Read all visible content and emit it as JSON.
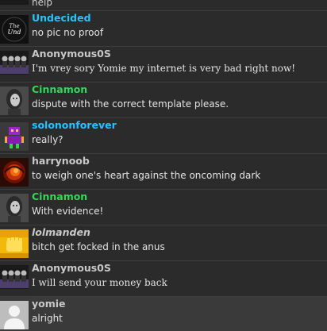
{
  "partial_message": {
    "text": "help",
    "avatar_icon": "anonymous-mask-avatar"
  },
  "messages": [
    {
      "user": "Undecided",
      "text": "no pic no proof",
      "user_color": "#23c4ff",
      "avatar_icon": "undecided-logo-avatar",
      "text_font": "sans"
    },
    {
      "user": "Anonymous0S",
      "text": "I'm vrey sory Yomie my internet is very bad right now!",
      "user_color": "#c8c8c8",
      "avatar_icon": "anonymous-mask-avatar",
      "text_font": "serif"
    },
    {
      "user": "Cinnamon",
      "text": "dispute with the correct template please.",
      "user_color": "#35d65a",
      "avatar_icon": "girl-portrait-avatar",
      "text_font": "sans"
    },
    {
      "user": "solononforever",
      "text": "really?",
      "user_color": "#23c4ff",
      "avatar_icon": "purple-robot-avatar",
      "text_font": "sans"
    },
    {
      "user": "harrynoob",
      "text": "to weigh one's heart against the oncoming dark",
      "user_color": "#c8c8c8",
      "avatar_icon": "fire-swirl-avatar",
      "text_font": "sans"
    },
    {
      "user": "Cinnamon",
      "text": "With evidence!",
      "user_color": "#35d65a",
      "avatar_icon": "girl-portrait-avatar",
      "text_font": "sans"
    },
    {
      "user": "lolmanden",
      "text": "bitch get focked in the anus",
      "user_color": "#c8c8c8",
      "avatar_icon": "yellow-fist-avatar",
      "text_font": "sans",
      "user_italic": true
    },
    {
      "user": "Anonymous0S",
      "text": "I will send your money back",
      "user_color": "#c8c8c8",
      "avatar_icon": "anonymous-mask-avatar",
      "text_font": "serif"
    },
    {
      "user": "yomie",
      "text": "alright",
      "user_color": "#c8c8c8",
      "avatar_icon": "default-user-avatar",
      "text_font": "sans",
      "highlighted": true
    }
  ]
}
